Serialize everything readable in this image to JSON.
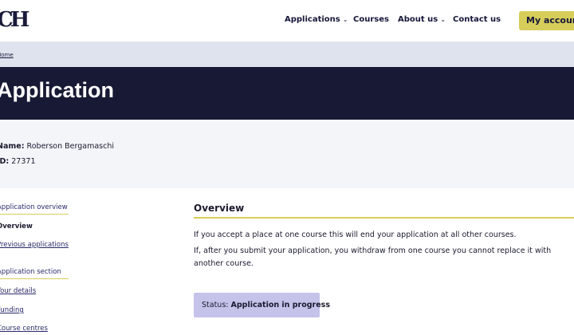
{
  "header": {
    "logo": "CH",
    "nav": [
      {
        "label": "Applications",
        "has_dropdown": true
      },
      {
        "label": "Courses",
        "has_dropdown": false
      },
      {
        "label": "About us",
        "has_dropdown": true
      },
      {
        "label": "Contact us",
        "has_dropdown": false
      }
    ],
    "account_label": "My account"
  },
  "breadcrumb": {
    "home": "Home"
  },
  "page": {
    "title": "Application"
  },
  "applicant": {
    "name_label": "Name:",
    "name": "Roberson Bergamaschi",
    "id_label": "ID:",
    "id": "27371"
  },
  "sidebar": {
    "overview_heading": "Application overview",
    "overview_current": "Overview",
    "previous_link": "Previous applications",
    "section_heading": "Application section",
    "links": [
      "Your details",
      "Funding",
      "Course centres"
    ]
  },
  "main": {
    "section_title": "Overview",
    "para1": "If you accept a place at one course this will end your application at all other courses.",
    "para2": "If, after you submit your application, you withdraw from one course you cannot replace it with another course.",
    "status_label": "Status:",
    "status_value": "Application in progress"
  },
  "colors": {
    "accent": "#d6cd5a",
    "hero_bg": "#181934",
    "breadcrumb_bg": "#dfe3ee",
    "status_bg": "#c5c3ea"
  }
}
